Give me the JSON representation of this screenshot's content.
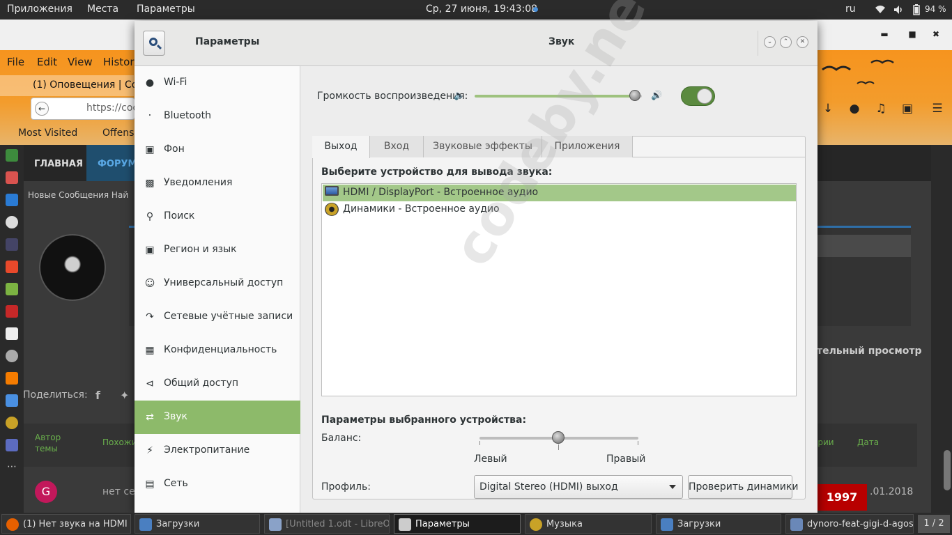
{
  "top_panel": {
    "menu": [
      "Приложения",
      "Места",
      "Параметры"
    ],
    "clock": "Ср, 27 июня, 19:43:08",
    "lang": "ru",
    "battery": "94 %"
  },
  "browser": {
    "menu": [
      "File",
      "Edit",
      "View",
      "History"
    ],
    "tab_title": "(1) Оповещения | Co...",
    "url": "https://cod",
    "bookmarks": [
      "Most Visited",
      "Offensi"
    ],
    "nav_home": "ГЛАВНАЯ",
    "nav_forum": "ФОРУМ",
    "subnav": "Новые Сообщения   Най",
    "preview": "тельный просмотр",
    "share": "Поделиться:",
    "author_col": "Автор темы",
    "similar_col": "Похожи",
    "replies_col": "арии",
    "date_col": "Дата",
    "row_avatar": "G",
    "row_text": "нет сет",
    "badge": "1997",
    "row_date": ".01.2018"
  },
  "settings": {
    "header_left": "Параметры",
    "header_title": "Звук",
    "sidebar": [
      {
        "label": "Wi-Fi",
        "icon": "wifi-icon"
      },
      {
        "label": "Bluetooth",
        "icon": "bluetooth-icon"
      },
      {
        "label": "Фон",
        "icon": "background-icon"
      },
      {
        "label": "Уведомления",
        "icon": "notifications-icon"
      },
      {
        "label": "Поиск",
        "icon": "search-icon"
      },
      {
        "label": "Регион и язык",
        "icon": "region-icon"
      },
      {
        "label": "Универсальный доступ",
        "icon": "accessibility-icon"
      },
      {
        "label": "Сетевые учётные записи",
        "icon": "online-accounts-icon"
      },
      {
        "label": "Конфиденциальность",
        "icon": "privacy-icon"
      },
      {
        "label": "Общий доступ",
        "icon": "share-icon"
      },
      {
        "label": "Звук",
        "icon": "sound-icon",
        "active": true
      },
      {
        "label": "Электропитание",
        "icon": "power-icon"
      },
      {
        "label": "Сеть",
        "icon": "network-icon"
      }
    ],
    "volume_label": "Громкость воспроизведения:",
    "volume_level": 0.96,
    "tabs": [
      "Выход",
      "Вход",
      "Звуковые эффекты",
      "Приложения"
    ],
    "output_label": "Выберите устройство для вывода звука:",
    "devices": [
      {
        "label": "HDMI / DisplayPort - Встроенное аудио",
        "selected": true
      },
      {
        "label": "Динамики - Встроенное аудио",
        "selected": false
      }
    ],
    "params_label": "Параметры выбранного устройства:",
    "balance_label": "Баланс:",
    "balance_left": "Левый",
    "balance_right": "Правый",
    "profile_label": "Профиль:",
    "profile_value": "Digital Stereo (HDMI) выход",
    "test_button": "Проверить динамики",
    "watermark": "codeby.net"
  },
  "taskbar": {
    "tasks": [
      {
        "label": "(1) Нет звука на HDMI ..."
      },
      {
        "label": "Загрузки"
      },
      {
        "label": "[Untitled 1.odt - LibreO..."
      },
      {
        "label": "Параметры",
        "active": true
      },
      {
        "label": "Музыка"
      },
      {
        "label": "Загрузки"
      },
      {
        "label": "dynoro-feat-gigi-d-agos..."
      }
    ],
    "pager": "1 / 2"
  },
  "colors": {
    "accent_green": "#8dba6a",
    "selection_green": "#a3c889",
    "browser_orange": "#f6941e"
  }
}
